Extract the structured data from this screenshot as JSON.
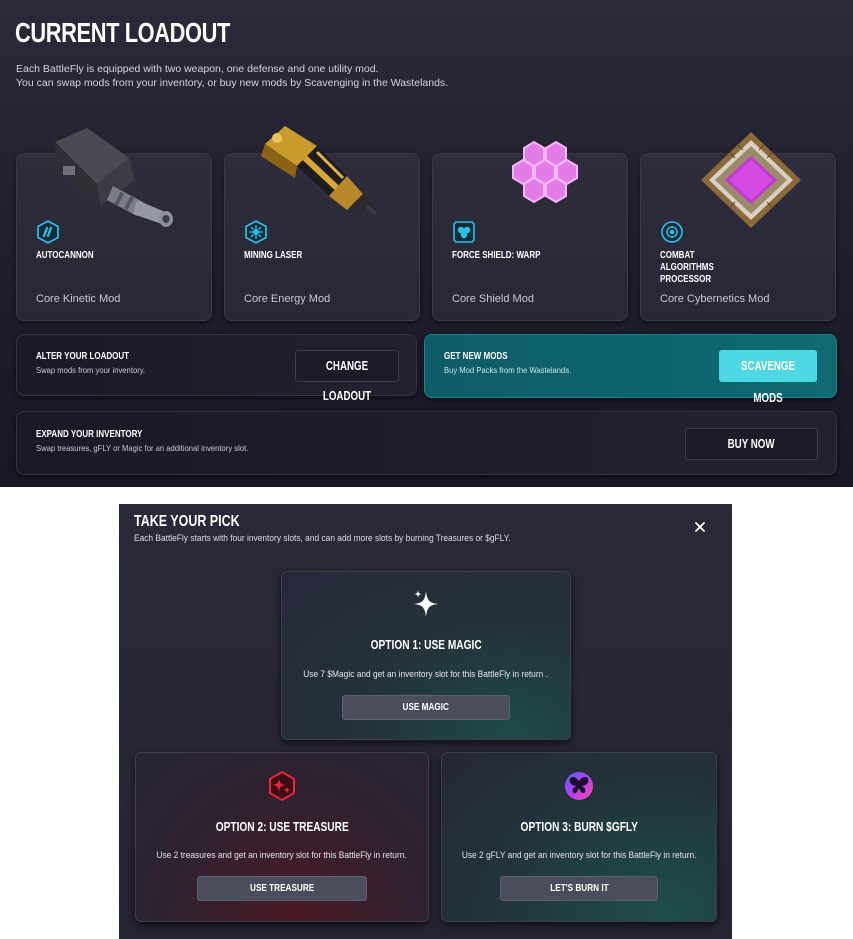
{
  "loadout": {
    "title": "CURRENT LOADOUT",
    "intro_line1": "Each BattleFly is equipped with two weapon, one defense and one utility mod.",
    "intro_line2": "You can swap mods from your inventory, or buy new mods by Scavenging in the Wastelands.",
    "mods": [
      {
        "name": "AUTOCANNON",
        "type": "Core Kinetic Mod",
        "icon": "kinetic-icon",
        "art": "autocannon-image"
      },
      {
        "name": "MINING LASER",
        "type": "Core Energy Mod",
        "icon": "energy-icon",
        "art": "mining-laser-image"
      },
      {
        "name": "FORCE SHIELD: WARP",
        "type": "Core Shield Mod",
        "icon": "shield-icon",
        "art": "force-shield-image"
      },
      {
        "name": "COMBAT ALGORITHMS PROCESSOR",
        "type": "Core Cybernetics Mod",
        "icon": "cybernetics-icon",
        "art": "processor-chip-image"
      }
    ],
    "alter": {
      "title": "ALTER YOUR LOADOUT",
      "subtitle": "Swap mods from your inventory.",
      "button": "CHANGE LOADOUT"
    },
    "new_mods": {
      "title": "GET NEW MODS",
      "subtitle": "Buy Mod Packs from the Wastelands.",
      "button": "SCAVENGE MODS"
    },
    "expand": {
      "title": "EXPAND YOUR INVENTORY",
      "subtitle": "Swap treasures, gFLY or Magic for an additional inventory slot.",
      "button": "BUY NOW"
    },
    "colors": {
      "accent_cyan": "#4dd8e4",
      "teal_panel": "#0e6670",
      "icon_blue": "#29c3e8"
    }
  },
  "modal": {
    "title": "TAKE YOUR PICK",
    "subtitle": "Each BattleFly starts with four inventory slots, and can add more slots by burning Treasures or $gFLY.",
    "close": "×",
    "options": [
      {
        "title": "OPTION 1: USE MAGIC",
        "desc": "Use 7 $Magic and get an inventory slot for this BattleFly in return .",
        "button": "USE MAGIC",
        "icon": "sparkles-icon"
      },
      {
        "title": "OPTION 2: USE TREASURE",
        "desc": "Use 2 treasures and get an inventory slot for this BattleFly in return.",
        "button": "USE TREASURE",
        "icon": "treasure-icon"
      },
      {
        "title": "OPTION 3: BURN $GFLY",
        "desc": "Use 2 gFLY and get an inventory slot for this BattleFly in return.",
        "button": "LET'S BURN IT",
        "icon": "gfly-butterfly-icon"
      }
    ]
  }
}
